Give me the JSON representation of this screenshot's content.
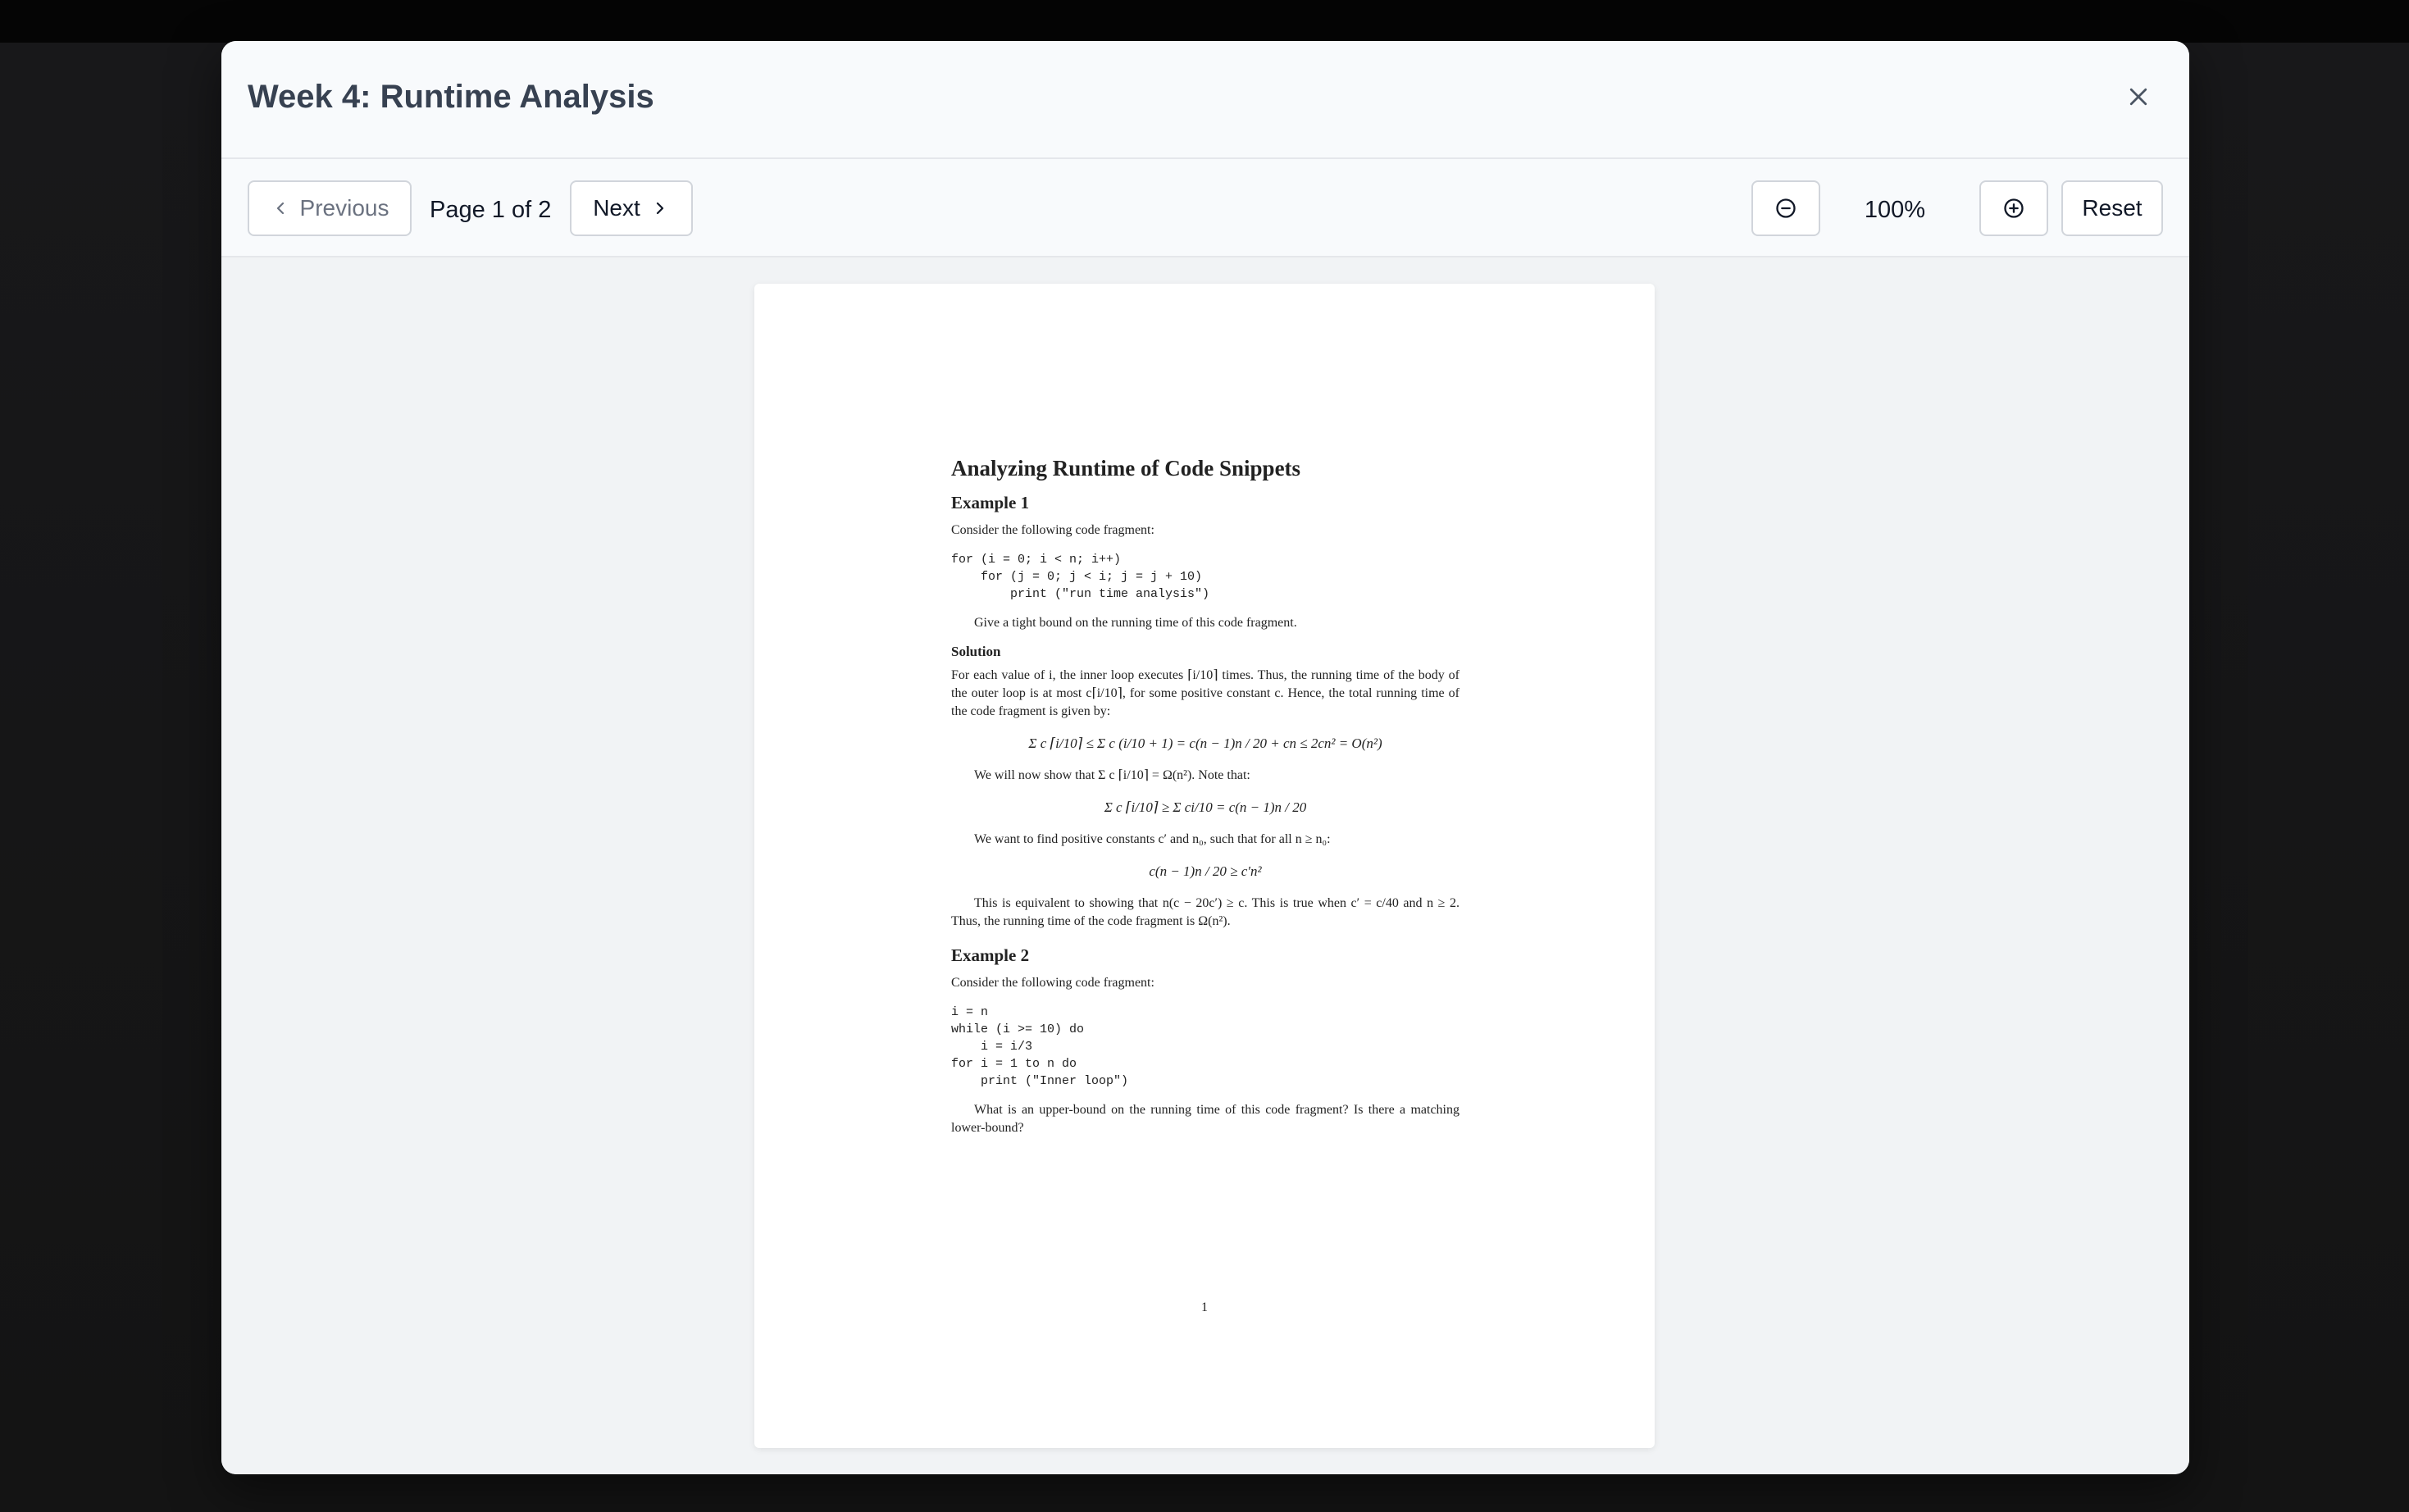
{
  "modal": {
    "title": "Week 4: Runtime Analysis"
  },
  "toolbar": {
    "previous_label": "Previous",
    "next_label": "Next",
    "page_indicator": "Page 1 of 2",
    "zoom_level": "100%",
    "reset_label": "Reset"
  },
  "icons": {
    "close": "close-icon",
    "previous": "chevron-left-icon",
    "next": "chevron-right-icon",
    "zoom_out": "zoom-out-icon",
    "zoom_in": "zoom-in-icon"
  },
  "document": {
    "title": "Analyzing Runtime of Code Snippets",
    "example1_heading": "Example 1",
    "example1_intro": "Consider the following code fragment:",
    "example1_code": "for (i = 0; i < n; i++)\n    for (j = 0; j < i; j = j + 10)\n        print (\"run time analysis\")",
    "example1_question": "Give a tight bound on the running time of this code fragment.",
    "solution_heading": "Solution",
    "solution_p1": "For each value of i, the inner loop executes ⌈i/10⌉ times. Thus, the running time of the body of the outer loop is at most c⌈i/10⌉, for some positive constant c. Hence, the total running time of the code fragment is given by:",
    "solution_eq1": "Σ c ⌈i/10⌉ ≤ Σ c (i/10 + 1) = c(n − 1)n / 20 + cn ≤ 2cn² = O(n²)",
    "solution_p2": "We will now show that Σ c ⌈i/10⌉ = Ω(n²). Note that:",
    "solution_eq2": "Σ c ⌈i/10⌉ ≥ Σ ci/10 = c(n − 1)n / 20",
    "solution_p3": "We want to find positive constants c′ and n₀, such that for all n ≥ n₀:",
    "solution_eq3": "c(n − 1)n / 20 ≥ c′n²",
    "solution_p4": "This is equivalent to showing that n(c − 20c′) ≥ c. This is true when c′ = c/40 and n ≥ 2. Thus, the running time of the code fragment is Ω(n²).",
    "example2_heading": "Example 2",
    "example2_intro": "Consider the following code fragment:",
    "example2_code": "i = n\nwhile (i >= 10) do\n    i = i/3\nfor i = 1 to n do\n    print (\"Inner loop\")",
    "example2_question": "What is an upper-bound on the running time of this code fragment? Is there a matching lower-bound?",
    "page_number": "1"
  }
}
